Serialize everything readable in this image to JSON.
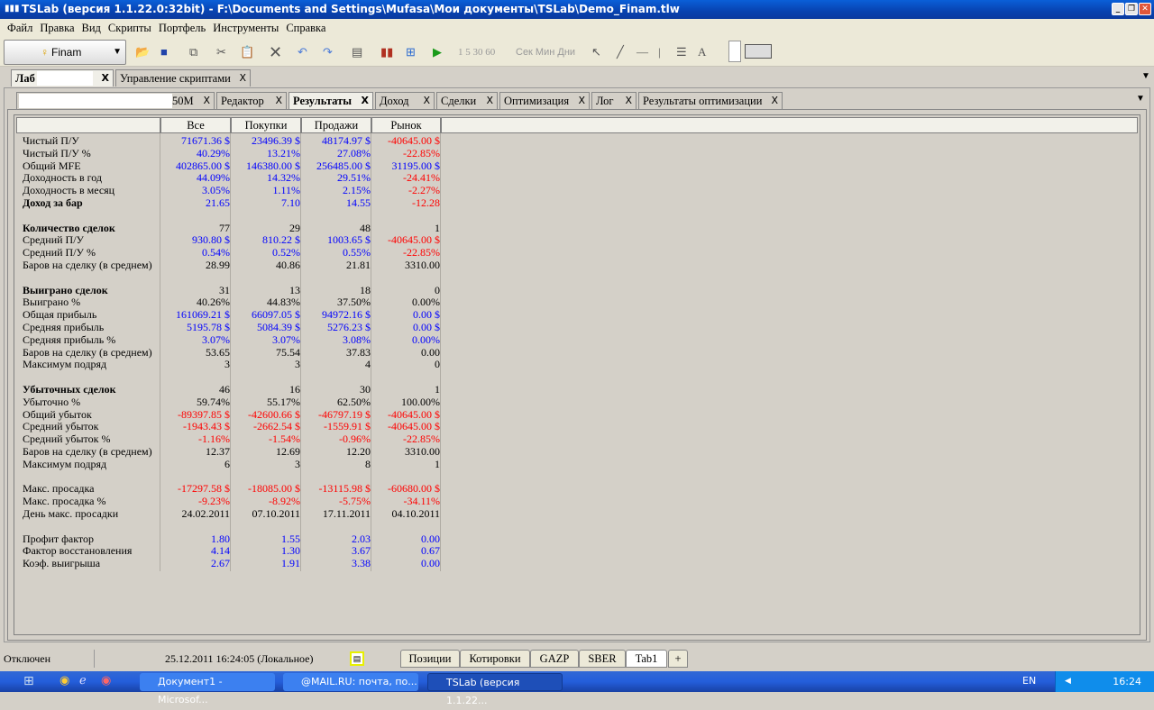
{
  "window": {
    "title": "TSLab (версия 1.1.22.0:32bit) - F:\\Documents and Settings\\Mufasa\\Мои документы\\TSLab\\Demo_Finam.tlw",
    "min": "_",
    "restore": "❐",
    "close": "✕"
  },
  "menu": [
    "Файл",
    "Правка",
    "Вид",
    "Скрипты",
    "Портфель",
    "Инструменты",
    "Справка"
  ],
  "toolbar": {
    "broker": "Finam",
    "intervals": "1 5 30 60",
    "units": "Сек Мин Дни"
  },
  "top_tabs": [
    {
      "label": "Лаб"
    },
    {
      "label": "Управление скриптами"
    }
  ],
  "sub_tabs": [
    {
      "label": "50М"
    },
    {
      "label": "Редактор"
    },
    {
      "label": "Результаты",
      "active": true
    },
    {
      "label": "Доход"
    },
    {
      "label": "Сделки"
    },
    {
      "label": "Оптимизация"
    },
    {
      "label": "Лог"
    },
    {
      "label": "Результаты оптимизации"
    }
  ],
  "colors": {
    "b": "#0000ff",
    "r": "#ff0000",
    "k": "#000000"
  },
  "results": {
    "columns": [
      "Все",
      "Покупки",
      "Продажи",
      "Рынок"
    ],
    "rows": [
      {
        "label": "Чистый П/У",
        "values": [
          "71671.36 $",
          "23496.39 $",
          "48174.97 $",
          "-40645.00 $"
        ],
        "c": "bbbr"
      },
      {
        "label": "Чистый П/У %",
        "values": [
          "40.29%",
          "13.21%",
          "27.08%",
          "-22.85%"
        ],
        "c": "bbbr"
      },
      {
        "label": "Общий MFE",
        "values": [
          "402865.00 $",
          "146380.00 $",
          "256485.00 $",
          "31195.00 $"
        ],
        "c": "bbbb"
      },
      {
        "label": "Доходность в год",
        "values": [
          "44.09%",
          "14.32%",
          "29.51%",
          "-24.41%"
        ],
        "c": "bbbr"
      },
      {
        "label": "Доходность в месяц",
        "values": [
          "3.05%",
          "1.11%",
          "2.15%",
          "-2.27%"
        ],
        "c": "bbbr"
      },
      {
        "label": "Доход за бар",
        "bold": true,
        "values": [
          "21.65",
          "7.10",
          "14.55",
          "-12.28"
        ],
        "c": "bbbr"
      },
      null,
      {
        "label": "Количество сделок",
        "bold": true,
        "values": [
          "77",
          "29",
          "48",
          "1"
        ],
        "c": "kkkk"
      },
      {
        "label": "Средний П/У",
        "values": [
          "930.80 $",
          "810.22 $",
          "1003.65 $",
          "-40645.00 $"
        ],
        "c": "bbbr"
      },
      {
        "label": "Средний П/У %",
        "values": [
          "0.54%",
          "0.52%",
          "0.55%",
          "-22.85%"
        ],
        "c": "bbbr"
      },
      {
        "label": "Баров на сделку (в среднем)",
        "values": [
          "28.99",
          "40.86",
          "21.81",
          "3310.00"
        ],
        "c": "kkkk"
      },
      null,
      {
        "label": "Выиграно сделок",
        "bold": true,
        "values": [
          "31",
          "13",
          "18",
          "0"
        ],
        "c": "kkkk"
      },
      {
        "label": "Выиграно %",
        "values": [
          "40.26%",
          "44.83%",
          "37.50%",
          "0.00%"
        ],
        "c": "kkkk"
      },
      {
        "label": "Общая прибыль",
        "values": [
          "161069.21 $",
          "66097.05 $",
          "94972.16 $",
          "0.00 $"
        ],
        "c": "bbbb"
      },
      {
        "label": "Средняя прибыль",
        "values": [
          "5195.78 $",
          "5084.39 $",
          "5276.23 $",
          "0.00 $"
        ],
        "c": "bbbb"
      },
      {
        "label": "Средняя прибыль %",
        "values": [
          "3.07%",
          "3.07%",
          "3.08%",
          "0.00%"
        ],
        "c": "bbbb"
      },
      {
        "label": "Баров на сделку (в среднем)",
        "values": [
          "53.65",
          "75.54",
          "37.83",
          "0.00"
        ],
        "c": "kkkk"
      },
      {
        "label": "Максимум подряд",
        "values": [
          "3",
          "3",
          "4",
          "0"
        ],
        "c": "kkkk"
      },
      null,
      {
        "label": "Убыточных сделок",
        "bold": true,
        "values": [
          "46",
          "16",
          "30",
          "1"
        ],
        "c": "kkkk"
      },
      {
        "label": "Убыточно %",
        "values": [
          "59.74%",
          "55.17%",
          "62.50%",
          "100.00%"
        ],
        "c": "kkkk"
      },
      {
        "label": "Общий убыток",
        "values": [
          "-89397.85 $",
          "-42600.66 $",
          "-46797.19 $",
          "-40645.00 $"
        ],
        "c": "rrrr"
      },
      {
        "label": "Средний убыток",
        "values": [
          "-1943.43 $",
          "-2662.54 $",
          "-1559.91 $",
          "-40645.00 $"
        ],
        "c": "rrrr"
      },
      {
        "label": "Средний убыток %",
        "values": [
          "-1.16%",
          "-1.54%",
          "-0.96%",
          "-22.85%"
        ],
        "c": "rrrr"
      },
      {
        "label": "Баров на сделку (в среднем)",
        "values": [
          "12.37",
          "12.69",
          "12.20",
          "3310.00"
        ],
        "c": "kkkk"
      },
      {
        "label": "Максимум подряд",
        "values": [
          "6",
          "3",
          "8",
          "1"
        ],
        "c": "kkkk"
      },
      null,
      {
        "label": "Макс. просадка",
        "values": [
          "-17297.58 $",
          "-18085.00 $",
          "-13115.98 $",
          "-60680.00 $"
        ],
        "c": "rrrr"
      },
      {
        "label": "Макс. просадка %",
        "values": [
          "-9.23%",
          "-8.92%",
          "-5.75%",
          "-34.11%"
        ],
        "c": "rrrr"
      },
      {
        "label": "День макс. просадки",
        "values": [
          "24.02.2011",
          "07.10.2011",
          "17.11.2011",
          "04.10.2011"
        ],
        "c": "kkkk"
      },
      null,
      {
        "label": "Профит фактор",
        "values": [
          "1.80",
          "1.55",
          "2.03",
          "0.00"
        ],
        "c": "bbbb"
      },
      {
        "label": "Фактор восстановления",
        "values": [
          "4.14",
          "1.30",
          "3.67",
          "0.67"
        ],
        "c": "bbbb"
      },
      {
        "label": "Коэф. выигрыша",
        "values": [
          "2.67",
          "1.91",
          "3.38",
          "0.00"
        ],
        "c": "bbbb"
      }
    ]
  },
  "status": {
    "connection": "Отключен",
    "datetime": "25.12.2011 16:24:05 (Локальное)",
    "tabs": [
      "Позиции",
      "Котировки",
      "GAZP",
      "SBER",
      "Tab1"
    ],
    "add": "+"
  },
  "taskbar": {
    "tasks": [
      "Документ1 - Microsof...",
      "@MAIL.RU: почта, по...",
      "TSLab (версия 1.1.22..."
    ],
    "lang": "EN",
    "clock": "16:24"
  }
}
